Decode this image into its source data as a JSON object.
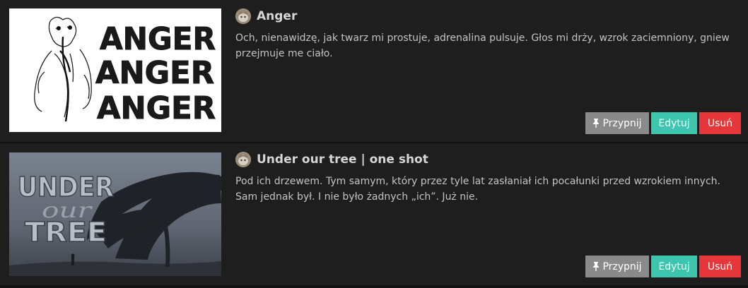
{
  "stories": [
    {
      "title": "Anger",
      "description": "Och, nienawidzę, jak twarz mi prostuje, adrenalina pulsuje. Głos mi drży, wzrok zaciemniony, gniew przejmuje me ciało.",
      "cover_text": [
        "ANGER",
        "ANGER",
        "ANGER"
      ],
      "buttons": {
        "pin": "Przypnij",
        "edit": "Edytuj",
        "delete": "Usuń"
      }
    },
    {
      "title": "Under our tree | one shot",
      "description": "Pod ich drzewem. Tym samym, który przez tyle lat zasłaniał ich pocałunki przed wzrokiem innych. Sam jednak był. I nie było żadnych „ich”. Już nie.",
      "cover_text": [
        "UNDER",
        "our",
        "TREE"
      ],
      "buttons": {
        "pin": "Przypnij",
        "edit": "Edytuj",
        "delete": "Usuń"
      }
    }
  ],
  "colors": {
    "background": "#1e1e1e",
    "pin_button": "#8a8a8a",
    "edit_button": "#3cc6ad",
    "delete_button": "#e8373b"
  }
}
